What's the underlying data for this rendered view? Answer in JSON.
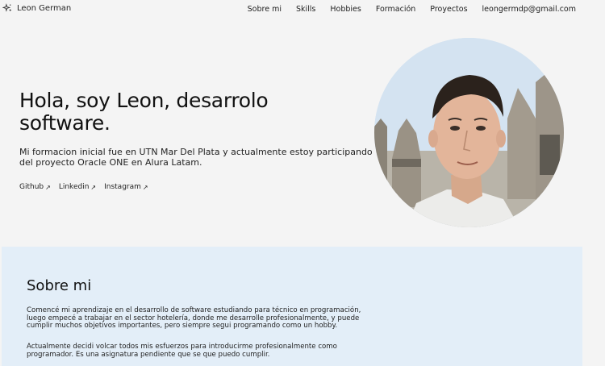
{
  "header": {
    "logo_text": "Leon German",
    "nav": [
      {
        "label": "Sobre mi"
      },
      {
        "label": "Skills"
      },
      {
        "label": "Hobbies"
      },
      {
        "label": "Formación"
      },
      {
        "label": "Proyectos"
      },
      {
        "label": "leongermdp@gmail.com"
      }
    ]
  },
  "hero": {
    "title": "Hola, soy Leon, desarrolo software.",
    "text": "Mi formacion inicial fue en UTN Mar Del Plata y actualmente estoy participando del proyecto Oracle ONE en Alura Latam.",
    "social": [
      {
        "label": "Github",
        "icon": "arrow-up-right-icon"
      },
      {
        "label": "Linkedin",
        "icon": "arrow-up-right-icon"
      },
      {
        "label": "Instagram",
        "icon": "arrow-up-right-icon"
      }
    ]
  },
  "about": {
    "title": "Sobre mi",
    "p1": "Comencé mi aprendizaje en el desarrollo de software estudiando para técnico en programación, luego empecé a trabajar en el sector hotelería, donde me desarrolle profesionalmente, y puede cumplir muchos objetivos importantes, pero siempre segui programando como un hobby.",
    "p2": "Actualmente decidi volcar todos mis esfuerzos para introducirme profesionalmente como programador. Es una asignatura pendiente que se que puedo cumplir."
  },
  "colors": {
    "background": "#f4f4f4",
    "about_background": "#e3eef8",
    "text": "#1d1d1d"
  }
}
